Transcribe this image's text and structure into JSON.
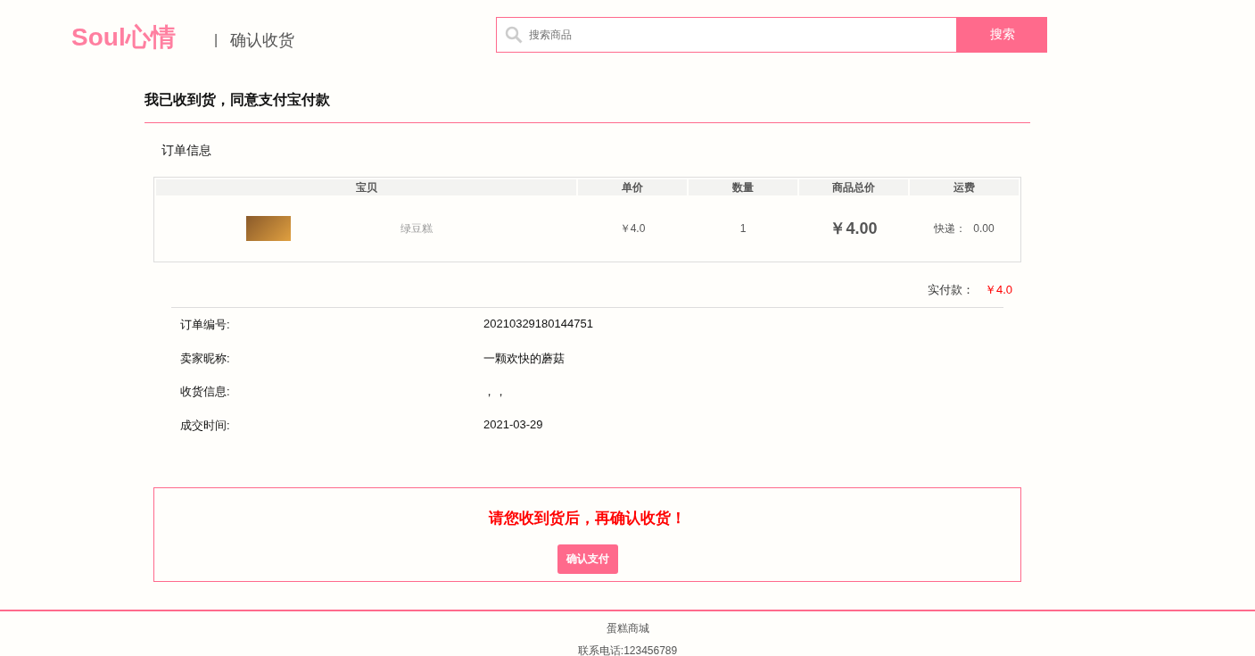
{
  "header": {
    "logo": "Soul心情",
    "separator": "|",
    "page_title": "确认收货",
    "search": {
      "placeholder": "搜索商品",
      "button": "搜索"
    }
  },
  "main": {
    "title": "我已收到货，同意支付宝付款",
    "section_label": "订单信息",
    "table": {
      "columns": [
        "宝贝",
        "单价",
        "数量",
        "商品总价",
        "运费"
      ],
      "rows": [
        {
          "product_name": "绿豆糕",
          "unit_price": "￥4.0",
          "quantity": "1",
          "total": "￥4.00",
          "shipping_label": "快递：",
          "shipping_fee": "0.00"
        }
      ]
    },
    "paid": {
      "label": "实付款：",
      "amount": "￥4.0"
    },
    "details": [
      {
        "label": "订单编号:",
        "value": "20210329180144751"
      },
      {
        "label": "卖家昵称:",
        "value": "一颗欢快的蘑菇"
      },
      {
        "label": "收货信息:",
        "value": "，，"
      },
      {
        "label": "成交时间:",
        "value": "2021-03-29"
      }
    ],
    "confirm": {
      "message": "请您收到货后，再确认收货！",
      "button": "确认支付"
    }
  },
  "footer": {
    "lines": [
      "蛋糕商城",
      "联系电话:123456789"
    ]
  }
}
